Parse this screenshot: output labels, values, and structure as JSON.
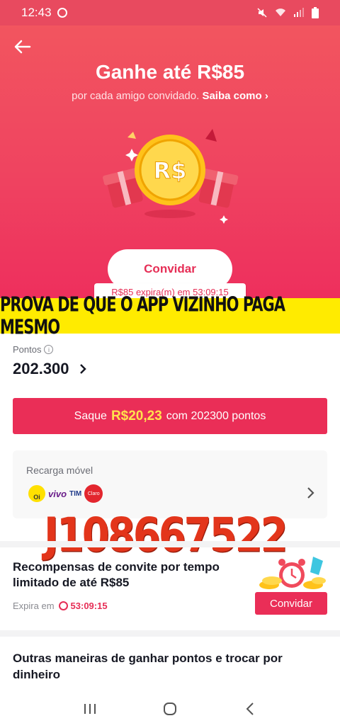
{
  "status_bar": {
    "time": "12:43"
  },
  "hero": {
    "title": "Ganhe até R$85",
    "subtitle": "por cada amigo convidado.",
    "learn_more": "Saiba como",
    "coin_text": "R$",
    "invite_button": "Convidar",
    "expire_tag": "R$85 expira(m) em 53:09:15"
  },
  "overlay_banner": "PROVA DE QUE O APP VIZINHO PAGA MESMO",
  "points": {
    "label": "Pontos",
    "value": "202.300"
  },
  "withdraw": {
    "prefix": "Saque",
    "amount": "R$20,23",
    "suffix": "com 202300 pontos"
  },
  "recharge": {
    "title": "Recarga móvel",
    "logos": {
      "oi": "Oi",
      "vivo": "vivo",
      "tim": "TIM",
      "claro": "Claro"
    }
  },
  "overlay_code": "J108667522",
  "reward": {
    "title": "Recompensas de convite por tempo limitado de até R$85",
    "expire_label": "Expira em",
    "timer": "53:09:15",
    "button": "Convidar"
  },
  "other": {
    "title": "Outras maneiras de ganhar pontos e trocar por dinheiro"
  },
  "colors": {
    "brand": "#ea2e57",
    "hero_top": "#f2555f",
    "banner": "#ffeb00",
    "amount": "#ffe34d",
    "code": "#e3351b"
  },
  "icons": [
    "back-arrow-icon",
    "whatsapp-icon",
    "mute-icon",
    "wifi-icon",
    "signal-icon",
    "battery-icon",
    "info-icon",
    "chevron-right-icon",
    "clock-icon",
    "recent-apps-icon",
    "home-icon",
    "back-nav-icon"
  ]
}
